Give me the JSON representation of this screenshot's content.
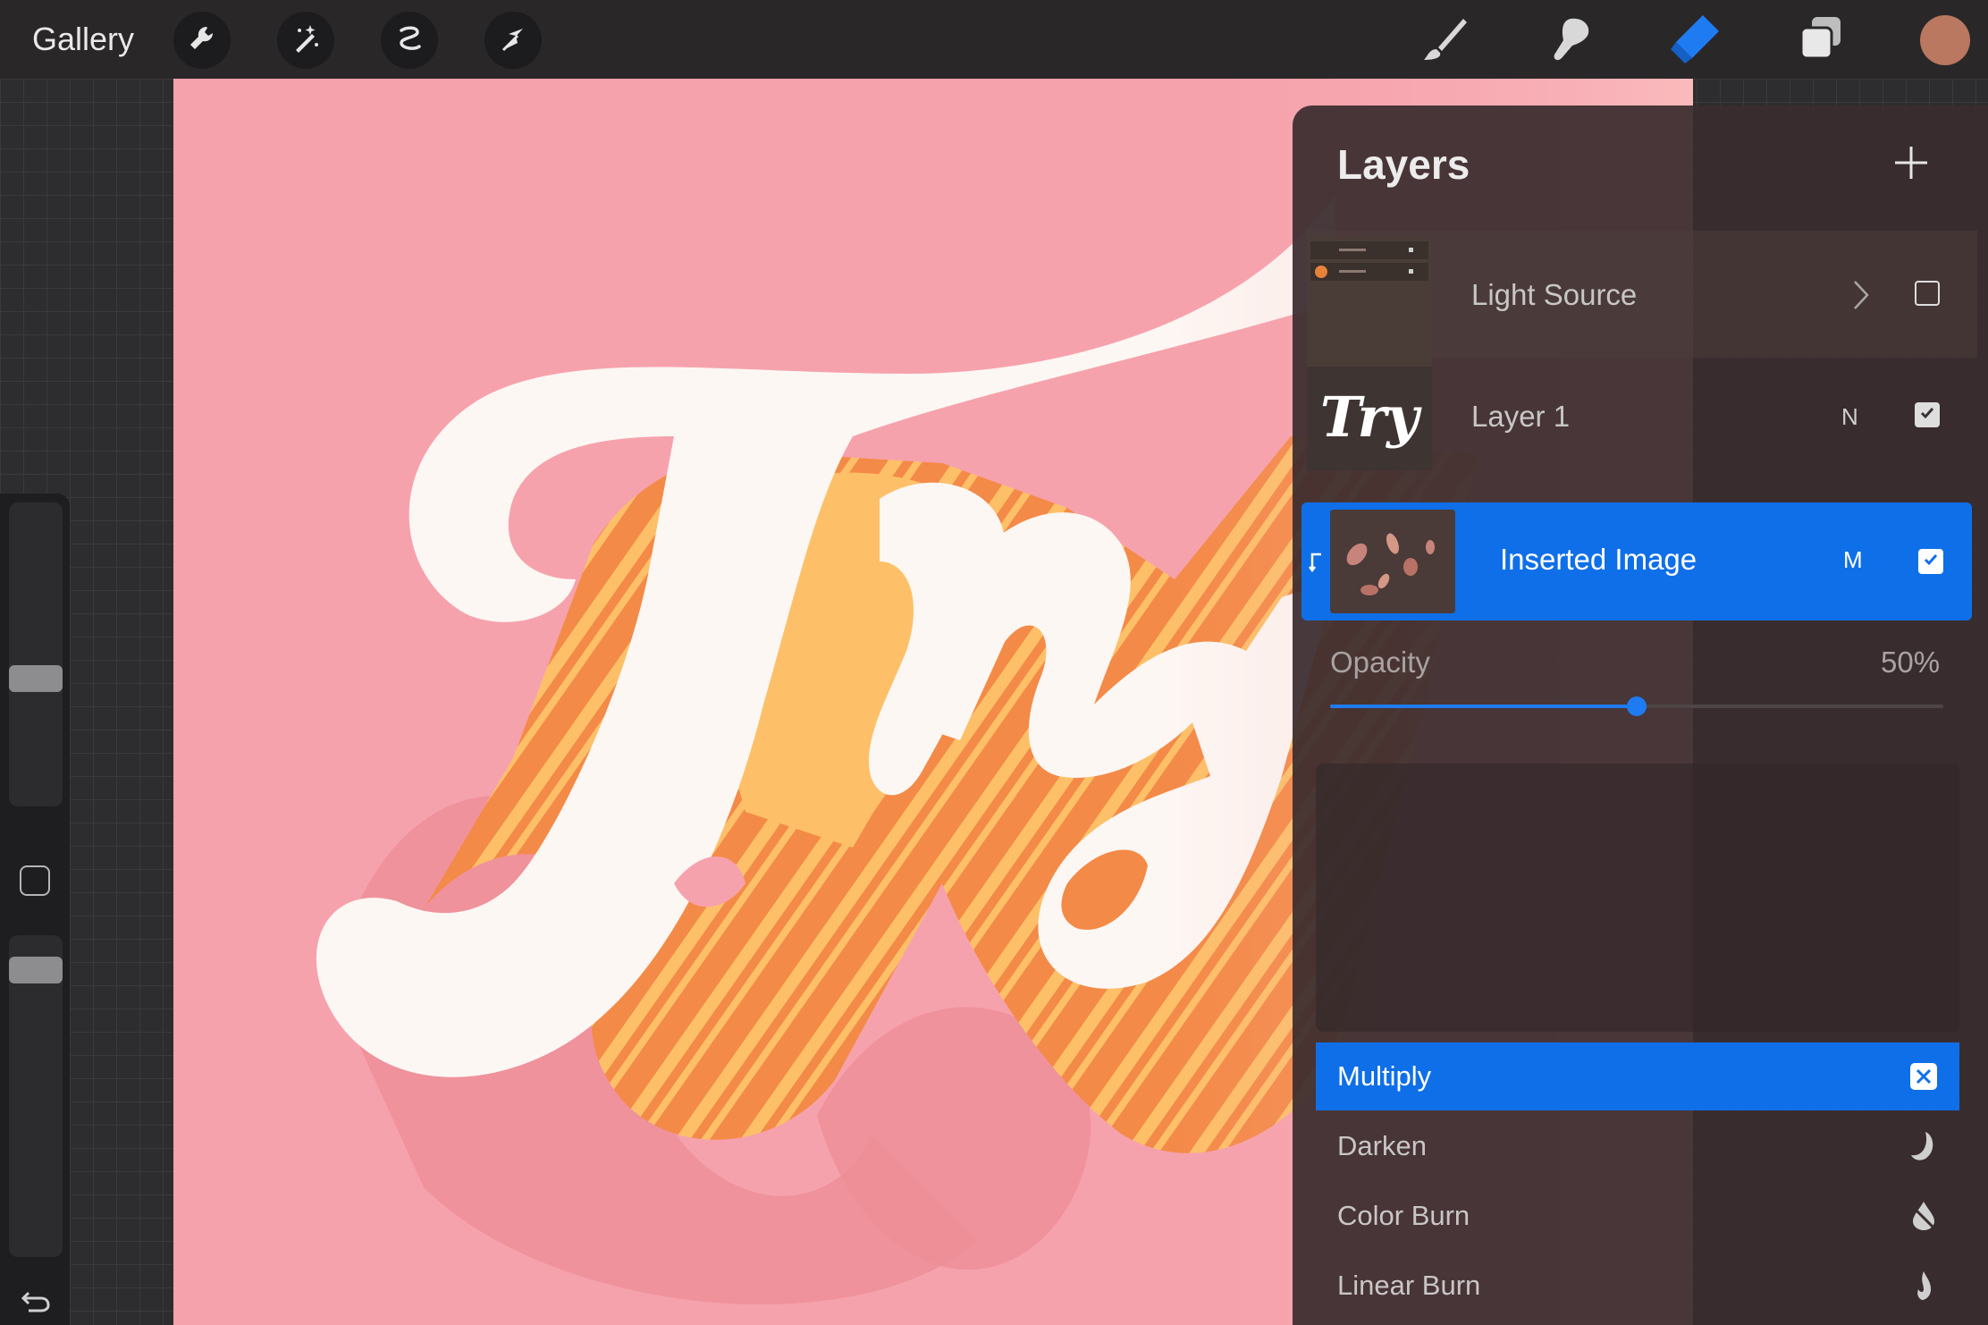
{
  "topbar": {
    "gallery_label": "Gallery",
    "tools_left": [
      "wrench-icon",
      "magic-wand-icon",
      "selection-icon",
      "transform-arrow-icon"
    ],
    "tools_right": [
      "brush-icon",
      "smudge-icon",
      "eraser-icon",
      "layers-icon"
    ],
    "active_tool": "eraser-icon",
    "color_swatch": "#b9785f"
  },
  "sidebar": {
    "brush_size_level": 0.55,
    "brush_opacity_level": 0.9
  },
  "canvas": {
    "background": "#f6a2ad",
    "artwork_text": "Try"
  },
  "layers_panel": {
    "title": "Layers",
    "layers": [
      {
        "name": "Light Source",
        "mode": "",
        "group": true,
        "visible": false
      },
      {
        "name": "Layer 1",
        "mode": "N",
        "group": false,
        "visible": true
      },
      {
        "name": "Inserted Image",
        "mode": "M",
        "group": false,
        "visible": true,
        "selected": true,
        "clipping_mask": true
      }
    ],
    "opacity": {
      "label": "Opacity",
      "value_text": "50%",
      "value": 50
    },
    "blend_modes": [
      {
        "label": "Multiply",
        "icon": "multiply-icon",
        "active": true
      },
      {
        "label": "Darken",
        "icon": "moon-icon",
        "active": false
      },
      {
        "label": "Color Burn",
        "icon": "burn-drop-icon",
        "active": false
      },
      {
        "label": "Linear Burn",
        "icon": "flame-icon",
        "active": false
      }
    ]
  },
  "colors": {
    "accent": "#0f6fe8",
    "canvas_pink": "#f6a2ad",
    "letter_white": "#fdf7f3",
    "shadow_orange": "#ec7a3f",
    "stripe_yellow": "#fdc068"
  }
}
